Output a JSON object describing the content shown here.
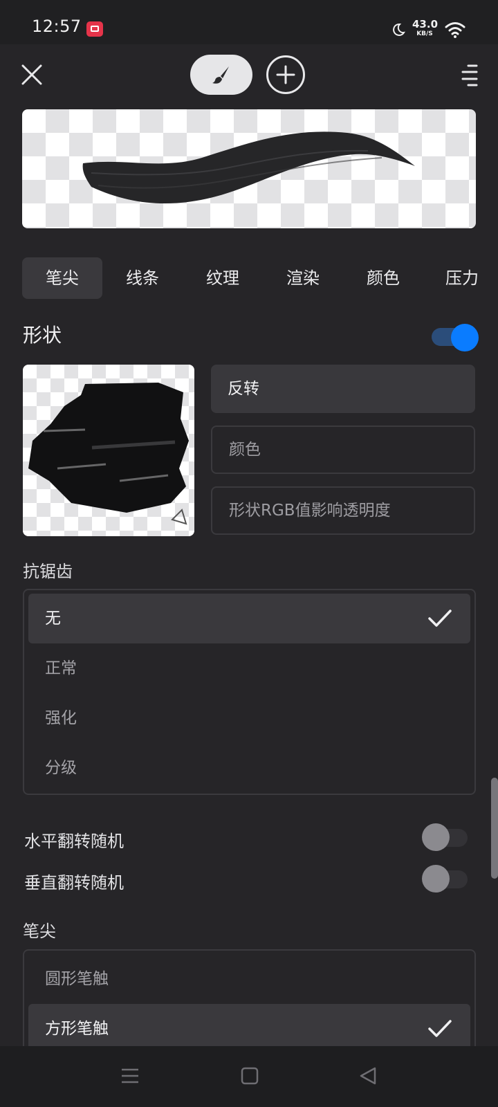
{
  "status_bar": {
    "time": "12:57",
    "net_speed": "43.0",
    "net_unit": "KB/S"
  },
  "toolbar": {
    "close_icon": "close-icon",
    "brush_icon": "brush-icon",
    "add_icon": "add-icon",
    "menu_icon": "menu-icon"
  },
  "tabs": [
    "笔尖",
    "线条",
    "纹理",
    "渲染",
    "颜色",
    "压力"
  ],
  "shape": {
    "title": "形状",
    "toggle_on": true,
    "options": [
      "反转",
      "颜色",
      "形状RGB值影响透明度"
    ]
  },
  "antialias": {
    "label": "抗锯齿",
    "items": [
      "无",
      "正常",
      "强化",
      "分级"
    ],
    "selected": "无"
  },
  "flip": {
    "horizontal": "水平翻转随机",
    "vertical": "垂直翻转随机",
    "horizontal_on": false,
    "vertical_on": false
  },
  "tip": {
    "label": "笔尖",
    "items": [
      "圆形笔触",
      "方形笔触"
    ],
    "selected": "方形笔触"
  },
  "colors": {
    "accent": "#0a7cff",
    "background": "#262528",
    "selected": "#3a393d"
  }
}
